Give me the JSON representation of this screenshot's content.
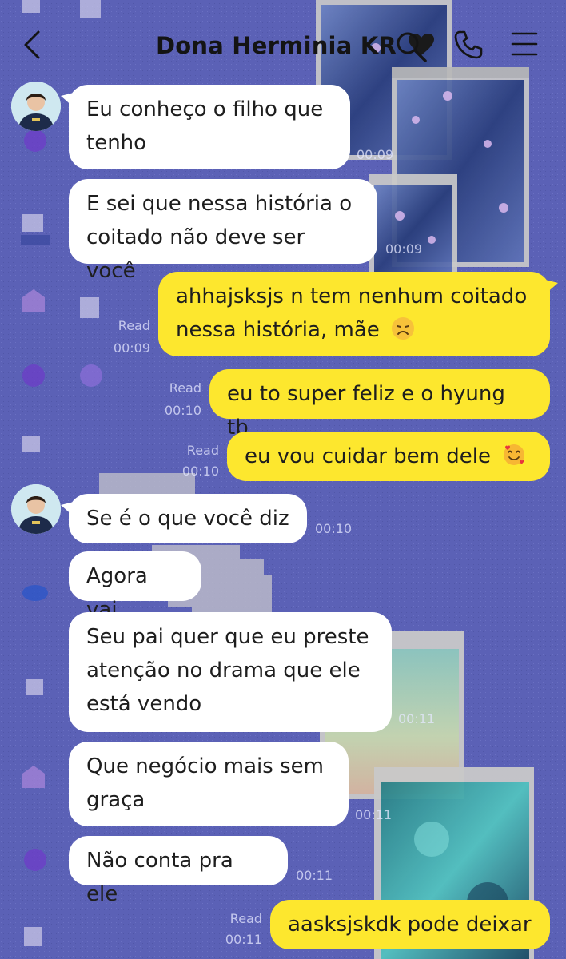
{
  "header": {
    "contact_name": "Dona Herminia KR",
    "name_emoji": "black-heart-icon",
    "icons": [
      "back-chevron-icon",
      "search-icon",
      "phone-icon",
      "menu-icon"
    ]
  },
  "messages": [
    {
      "side": "in",
      "lines": [
        "Eu conheço o filho que",
        "tenho"
      ],
      "time": "00:09",
      "avatar": true
    },
    {
      "side": "in",
      "lines": [
        "E sei que nessa história o",
        "coitado não deve ser você"
      ],
      "time": "00:09"
    },
    {
      "side": "out",
      "lines": [
        "ahhajsksjs n tem nenhum coitado",
        "nessa história, mãe"
      ],
      "emoji": "disappointed-face-icon",
      "read": "Read",
      "time": "00:09"
    },
    {
      "side": "out",
      "lines": [
        "eu to super feliz e o hyung tb"
      ],
      "read": "Read",
      "time": "00:10"
    },
    {
      "side": "out",
      "lines": [
        "eu vou cuidar bem dele"
      ],
      "emoji": "smiling-face-with-hearts-icon",
      "read": "Read",
      "time": "00:10"
    },
    {
      "side": "in",
      "lines": [
        "Se é o que você diz"
      ],
      "time": "00:10",
      "avatar": true
    },
    {
      "side": "in",
      "lines": [
        "Agora vai"
      ]
    },
    {
      "side": "in",
      "lines": [
        "Seu pai quer que eu preste",
        "atenção no drama que ele",
        "está vendo"
      ],
      "time": "00:11"
    },
    {
      "side": "in",
      "lines": [
        "Que negócio mais sem",
        "graça"
      ],
      "time": "00:11"
    },
    {
      "side": "in",
      "lines": [
        "Não conta pra ele"
      ],
      "time": "00:11"
    },
    {
      "side": "out",
      "lines": [
        "aasksjskdk pode deixar"
      ],
      "read": "Read",
      "time": "00:11"
    }
  ],
  "colors": {
    "background": "#5b61b6",
    "incoming_bubble": "#ffffff",
    "outgoing_bubble": "#fde72e",
    "text": "#1e1e1e"
  }
}
